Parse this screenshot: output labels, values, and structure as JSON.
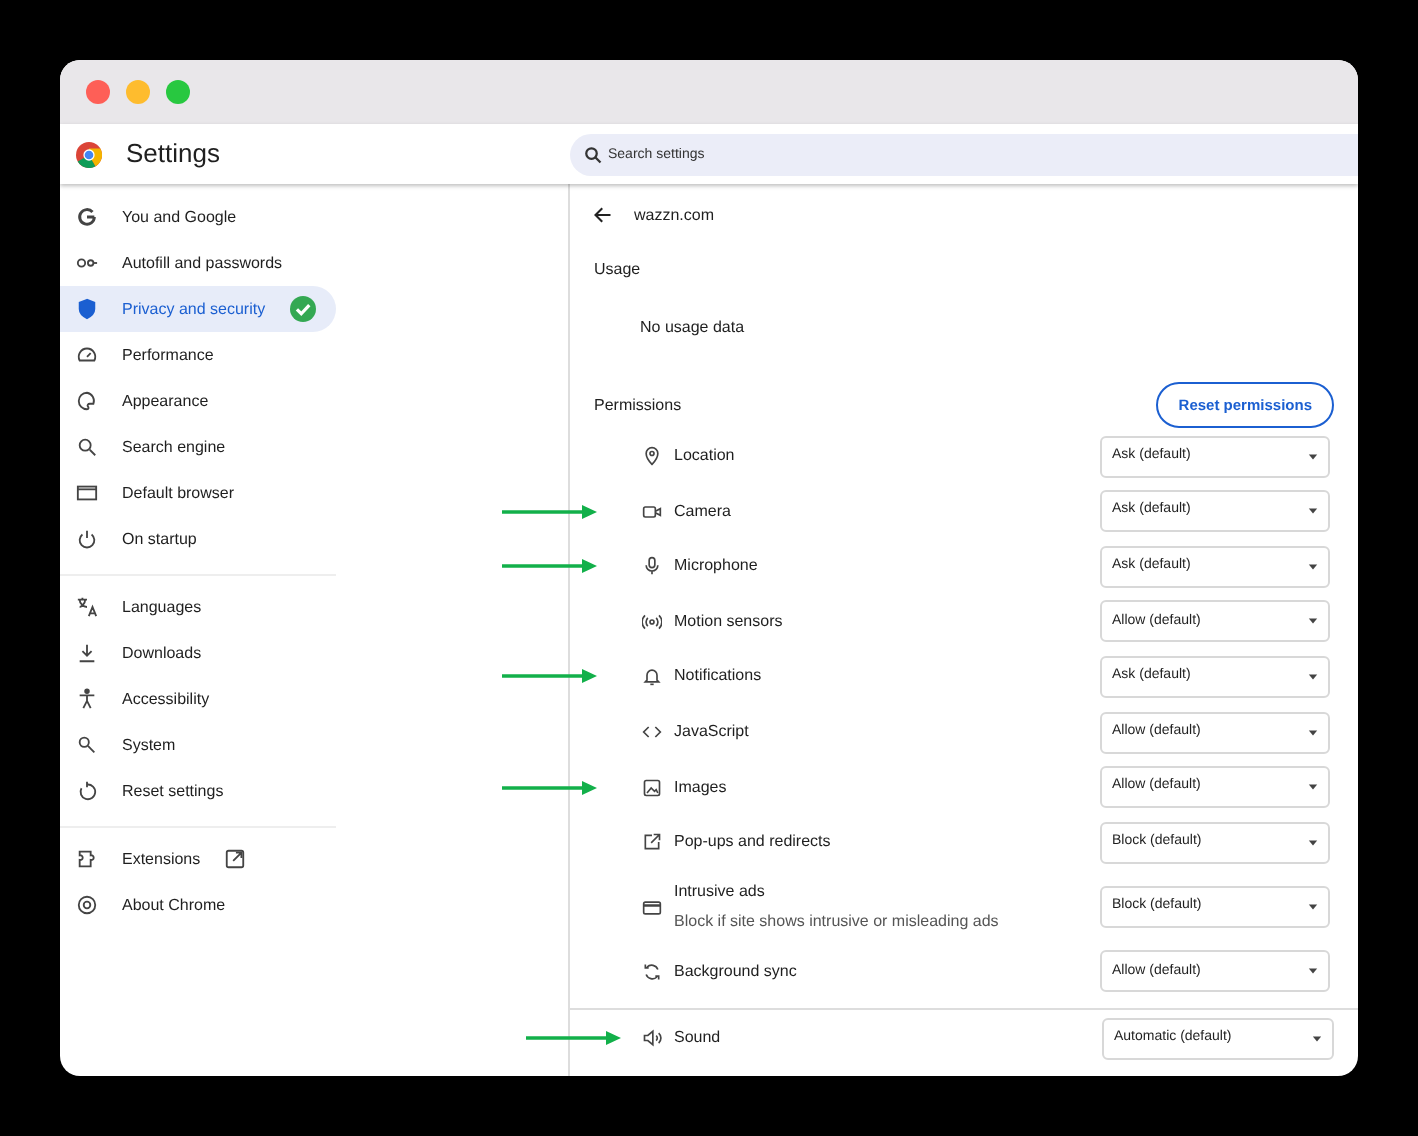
{
  "window": {
    "title": "Settings"
  },
  "search": {
    "placeholder": "Search settings"
  },
  "sidebar": {
    "groups": [
      [
        {
          "label": "You and Google",
          "selected": false,
          "kind": "link"
        },
        {
          "label": "Autofill and passwords",
          "selected": false,
          "kind": "link"
        },
        {
          "label": "Privacy and security",
          "selected": true,
          "kind": "link"
        },
        {
          "label": "Performance",
          "selected": false,
          "kind": "link"
        },
        {
          "label": "Appearance",
          "selected": false,
          "kind": "link"
        },
        {
          "label": "Search engine",
          "selected": false,
          "kind": "link"
        },
        {
          "label": "Default browser",
          "selected": false,
          "kind": "link"
        },
        {
          "label": "On startup",
          "selected": false,
          "kind": "link"
        }
      ],
      [
        {
          "label": "Languages",
          "selected": false,
          "kind": "link"
        },
        {
          "label": "Downloads",
          "selected": false,
          "kind": "link"
        },
        {
          "label": "Accessibility",
          "selected": false,
          "kind": "link"
        },
        {
          "label": "System",
          "selected": false,
          "kind": "link"
        },
        {
          "label": "Reset settings",
          "selected": false,
          "kind": "link"
        }
      ],
      [
        {
          "label": "Extensions",
          "selected": false,
          "kind": "external"
        },
        {
          "label": "About Chrome",
          "selected": false,
          "kind": "link"
        }
      ]
    ]
  },
  "site": {
    "name": "wazzn.com"
  },
  "usage": {
    "heading": "Usage",
    "text": "No usage data"
  },
  "permissions": {
    "heading": "Permissions",
    "reset_button": "Reset permissions",
    "rows": [
      {
        "label": "Location",
        "value": "Ask (default)",
        "highlighted": false,
        "kind": "inline"
      },
      {
        "label": "Camera",
        "value": "Ask (default)",
        "highlighted": true,
        "kind": "inline"
      },
      {
        "label": "Microphone",
        "value": "Ask (default)",
        "highlighted": true,
        "kind": "inline"
      },
      {
        "label": "Motion sensors",
        "value": "Allow (default)",
        "highlighted": false,
        "kind": "inline"
      },
      {
        "label": "Notifications",
        "value": "Ask (default)",
        "highlighted": true,
        "kind": "inline"
      },
      {
        "label": "JavaScript",
        "value": "Allow (default)",
        "highlighted": false,
        "kind": "inline"
      },
      {
        "label": "Images",
        "value": "Allow (default)",
        "highlighted": true,
        "kind": "inline"
      },
      {
        "label": "Pop-ups and redirects",
        "value": "Block (default)",
        "highlighted": false,
        "kind": "inline"
      },
      {
        "label": "Intrusive ads",
        "description": "Block if site shows intrusive or misleading ads",
        "value": "Block (default)",
        "highlighted": false,
        "kind": "inline"
      },
      {
        "label": "Background sync",
        "value": "Allow (default)",
        "highlighted": false,
        "kind": "inline"
      },
      {
        "label": "Sound",
        "value": "Automatic (default)",
        "highlighted": true,
        "kind": "detached"
      }
    ]
  }
}
